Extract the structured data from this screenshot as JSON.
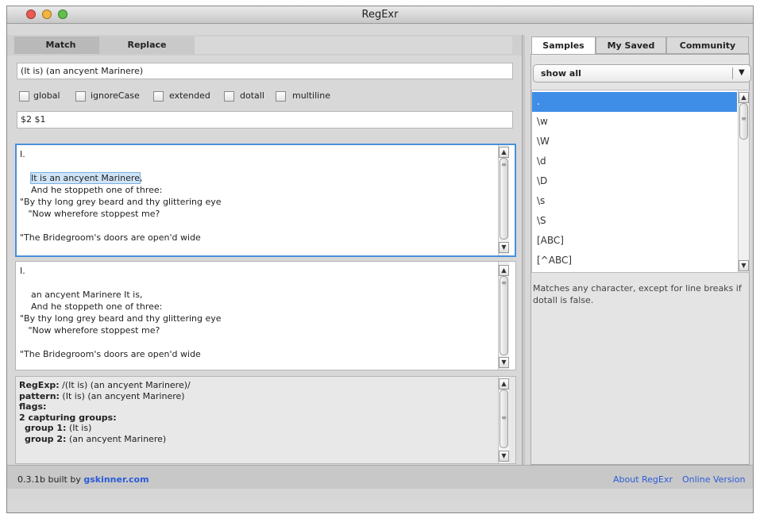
{
  "window": {
    "title": "RegExr"
  },
  "tabs": {
    "match": "Match",
    "replace": "Replace"
  },
  "pattern_input": {
    "value": "(It is) (an ancyent Marinere)"
  },
  "flags": [
    {
      "label": "global"
    },
    {
      "label": "ignoreCase"
    },
    {
      "label": "extended"
    },
    {
      "label": "dotall"
    },
    {
      "label": "multiline"
    }
  ],
  "replace_input": {
    "value": "$2 $1"
  },
  "source_text": {
    "line1": "I.",
    "highlight": "It is an ancyent Marinere",
    "after_highlight": ",",
    "rest": "    And he stoppeth one of three:\n\"By thy long grey beard and thy glittering eye\n   \"Now wherefore stoppest me?\n\n\"The Bridegroom's doors are open'd wide"
  },
  "result_text": "I.\n\n    an ancyent Marinere It is,\n    And he stoppeth one of three:\n\"By thy long grey beard and thy glittering eye\n   \"Now wherefore stoppest me?\n\n\"The Bridegroom's doors are open'd wide",
  "details": {
    "regexp_label": "RegExp:",
    "regexp_value": " /(It is) (an ancyent Marinere)/",
    "pattern_label": "pattern:",
    "pattern_value": " (It is) (an ancyent Marinere)",
    "flags_label": "flags:",
    "groups_label": "2 capturing groups:",
    "group1_label": "group 1:",
    "group1_value": " (It is)",
    "group2_label": "group 2:",
    "group2_value": " (an ancyent Marinere)"
  },
  "footer": {
    "version_text": "0.3.1b built by ",
    "author_link": "gskinner.com",
    "about_link": "About RegExr",
    "online_link": "Online Version"
  },
  "right_tabs": {
    "samples": "Samples",
    "my_saved": "My Saved",
    "community": "Community"
  },
  "filter_select": {
    "value": "show all"
  },
  "samples": [
    ".",
    "\\w",
    "\\W",
    "\\d",
    "\\D",
    "\\s",
    "\\S",
    "[ABC]",
    "[^ABC]"
  ],
  "sample_description": "Matches any character, except for line breaks if dotall is false.",
  "colors": {
    "selection": "#3e8ee8",
    "link": "#2a5bd7",
    "accent_border": "#4a90d9"
  },
  "icons": {
    "dropdown": "chevron-down-icon",
    "scroll_up": "arrow-up-icon",
    "scroll_down": "arrow-down-icon"
  }
}
